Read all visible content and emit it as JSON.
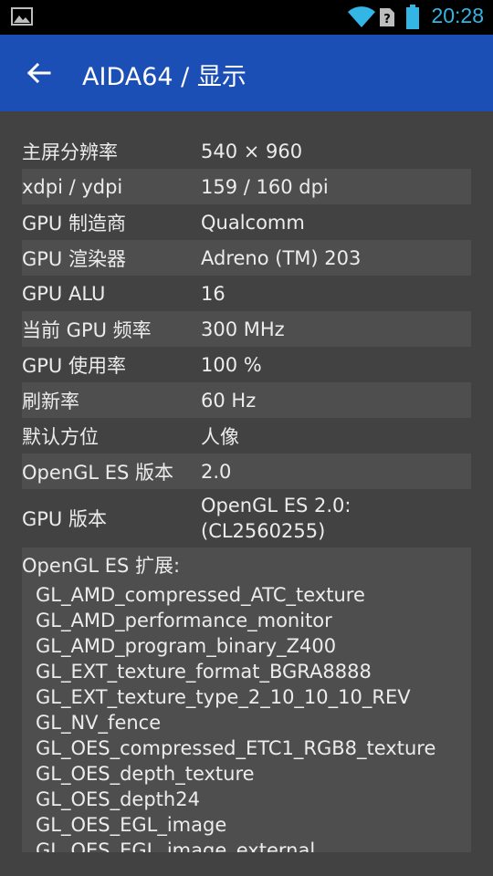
{
  "status": {
    "time": "20:28",
    "accent": "#33b5e5"
  },
  "appbar": {
    "title": "AIDA64  /  显示",
    "color": "#1b4fb5",
    "back_icon": "arrow-back-icon"
  },
  "rows": [
    {
      "label": "主屏分辨率",
      "value": "540 × 960"
    },
    {
      "label": "xdpi / ydpi",
      "value": "159 / 160 dpi"
    },
    {
      "label": "GPU 制造商",
      "value": "Qualcomm"
    },
    {
      "label": "GPU 渲染器",
      "value": "Adreno (TM) 203"
    },
    {
      "label": "GPU ALU",
      "value": "16"
    },
    {
      "label": "当前 GPU 频率",
      "value": "300 MHz"
    },
    {
      "label": "GPU 使用率",
      "value": "100 %"
    },
    {
      "label": "刷新率",
      "value": "60 Hz"
    },
    {
      "label": "默认方位",
      "value": "人像"
    },
    {
      "label": "OpenGL ES 版本",
      "value": "2.0"
    },
    {
      "label": "GPU 版本",
      "value_line1": "OpenGL ES 2.0:",
      "value_line2": "(CL2560255)"
    }
  ],
  "extensions": {
    "label": "OpenGL ES 扩展:",
    "items": [
      "GL_AMD_compressed_ATC_texture",
      "GL_AMD_performance_monitor",
      "GL_AMD_program_binary_Z400",
      "GL_EXT_texture_format_BGRA8888",
      "GL_EXT_texture_type_2_10_10_10_REV",
      "GL_NV_fence",
      "GL_OES_compressed_ETC1_RGB8_texture",
      "GL_OES_depth_texture",
      "GL_OES_depth24",
      "GL_OES_EGL_image",
      "GL_OES_EGL_image_external"
    ]
  }
}
